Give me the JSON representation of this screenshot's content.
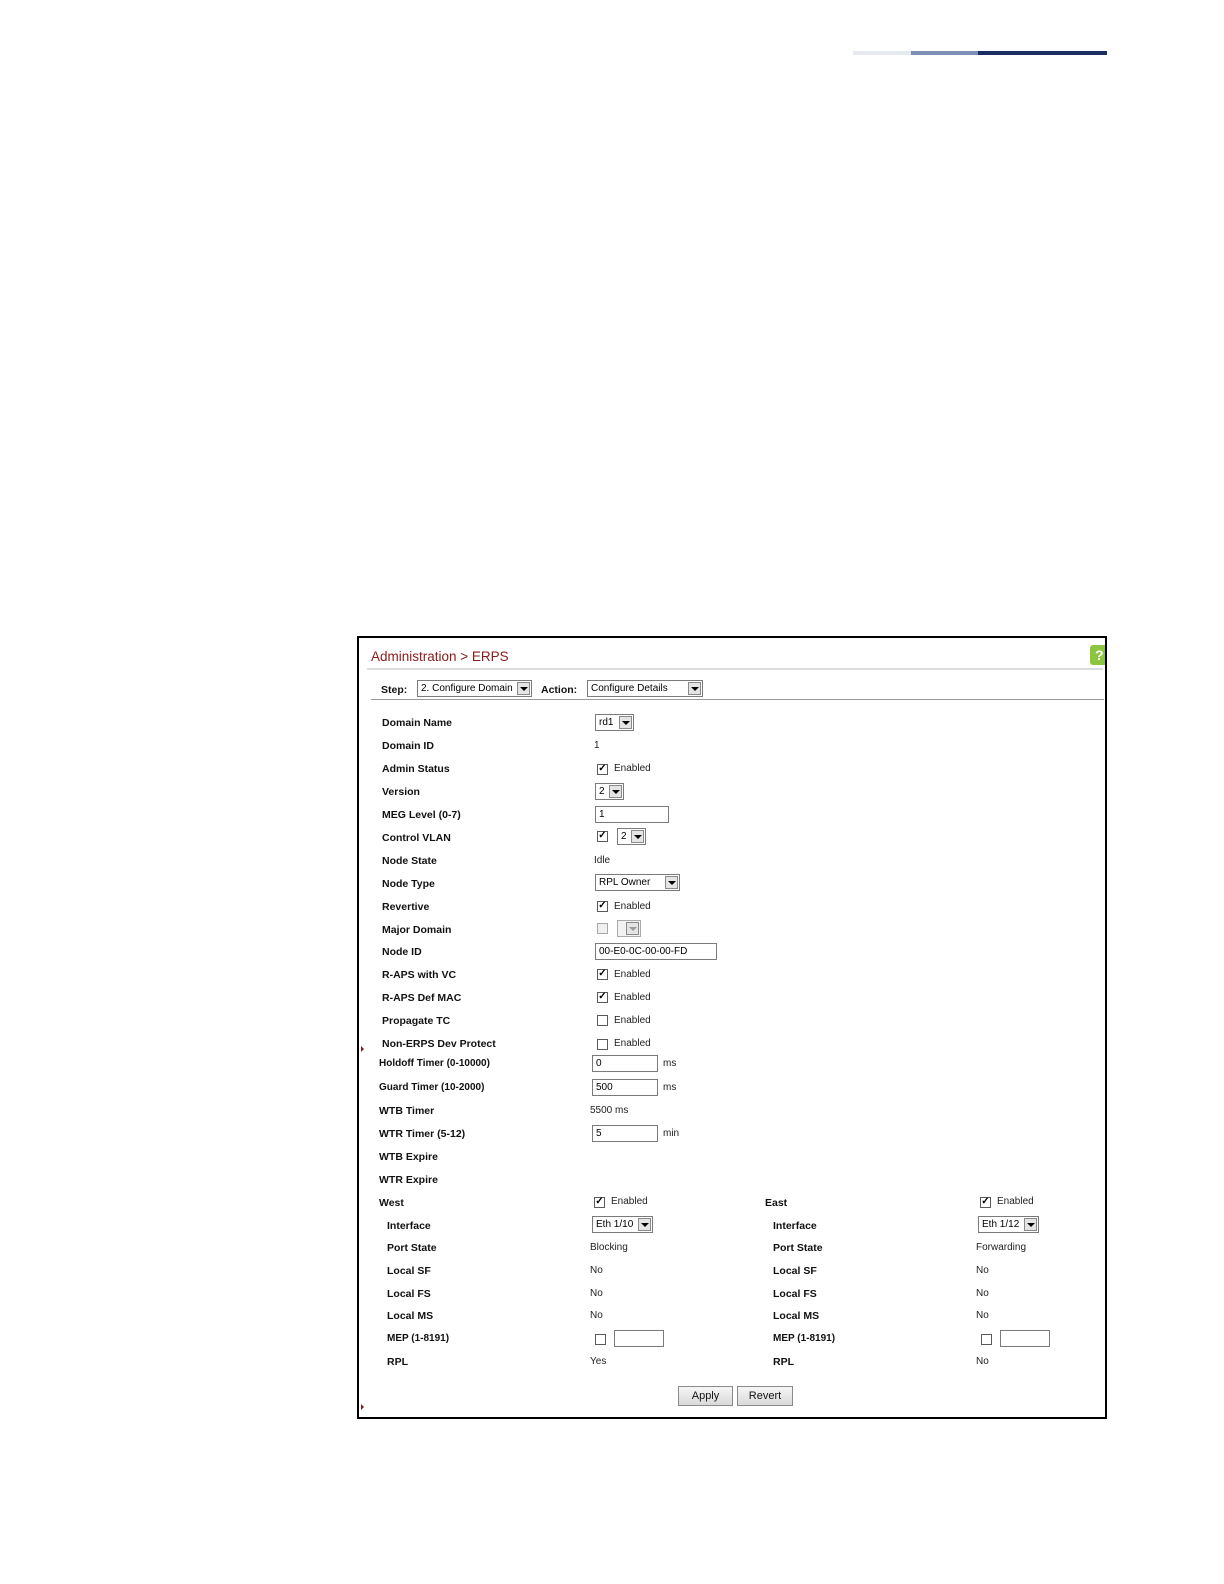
{
  "header": {
    "breadcrumb": "Administration > ERPS",
    "help_icon": "?"
  },
  "toolbar": {
    "step_label": "Step:",
    "step_value": "2. Configure Domain",
    "action_label": "Action:",
    "action_value": "Configure Details"
  },
  "fields": {
    "domain_name": {
      "label": "Domain Name",
      "value": "rd1"
    },
    "domain_id": {
      "label": "Domain ID",
      "value": "1"
    },
    "admin_status": {
      "label": "Admin Status",
      "checkbox": "Enabled",
      "checked": true
    },
    "version": {
      "label": "Version",
      "value": "2"
    },
    "meg_level": {
      "label": "MEG Level (0-7)",
      "value": "1"
    },
    "control_vlan": {
      "label": "Control VLAN",
      "checked": true,
      "value": "2"
    },
    "node_state": {
      "label": "Node State",
      "value": "Idle"
    },
    "node_type": {
      "label": "Node Type",
      "value": "RPL Owner"
    },
    "revertive": {
      "label": "Revertive",
      "checkbox": "Enabled",
      "checked": true
    },
    "major_domain": {
      "label": "Major Domain",
      "checked": false,
      "value": ""
    },
    "node_id": {
      "label": "Node ID",
      "value": "00-E0-0C-00-00-FD"
    },
    "raps_with_vc": {
      "label": "R-APS with VC",
      "checkbox": "Enabled",
      "checked": true
    },
    "raps_def_mac": {
      "label": "R-APS Def MAC",
      "checkbox": "Enabled",
      "checked": true
    },
    "propagate_tc": {
      "label": "Propagate TC",
      "checkbox": "Enabled",
      "checked": false
    },
    "non_erps_dev_protect": {
      "label": "Non-ERPS Dev Protect",
      "checkbox": "Enabled",
      "checked": false
    },
    "holdoff_timer": {
      "label": "Holdoff Timer (0-10000)",
      "value": "0",
      "unit": "ms"
    },
    "guard_timer": {
      "label": "Guard Timer (10-2000)",
      "value": "500",
      "unit": "ms"
    },
    "wtb_timer": {
      "label": "WTB Timer",
      "value": "5500 ms"
    },
    "wtr_timer": {
      "label": "WTR Timer (5-12)",
      "value": "5",
      "unit": "min"
    },
    "wtb_expire": {
      "label": "WTB Expire"
    },
    "wtr_expire": {
      "label": "WTR Expire"
    }
  },
  "west": {
    "label": "West",
    "checkbox": "Enabled",
    "checked": true,
    "interface_label": "Interface",
    "interface_value": "Eth 1/10",
    "port_state_label": "Port State",
    "port_state_value": "Blocking",
    "local_sf_label": "Local SF",
    "local_sf_value": "No",
    "local_fs_label": "Local FS",
    "local_fs_value": "No",
    "local_ms_label": "Local MS",
    "local_ms_value": "No",
    "mep_label": "MEP (1-8191)",
    "mep_checked": false,
    "mep_value": "",
    "rpl_label": "RPL",
    "rpl_value": "Yes"
  },
  "east": {
    "label": "East",
    "checkbox": "Enabled",
    "checked": true,
    "interface_label": "Interface",
    "interface_value": "Eth 1/12",
    "port_state_label": "Port State",
    "port_state_value": "Forwarding",
    "local_sf_label": "Local SF",
    "local_sf_value": "No",
    "local_fs_label": "Local FS",
    "local_fs_value": "No",
    "local_ms_label": "Local MS",
    "local_ms_value": "No",
    "mep_label": "MEP (1-8191)",
    "mep_checked": false,
    "mep_value": "",
    "rpl_label": "RPL",
    "rpl_value": "No"
  },
  "buttons": {
    "apply": "Apply",
    "revert": "Revert"
  },
  "colors": {
    "breadcrumb": "#8b1a1a",
    "help_icon": "#8cc63f",
    "accent_bar_dark": "#1b2e63",
    "accent_bar_mid": "#7d8fb5"
  }
}
